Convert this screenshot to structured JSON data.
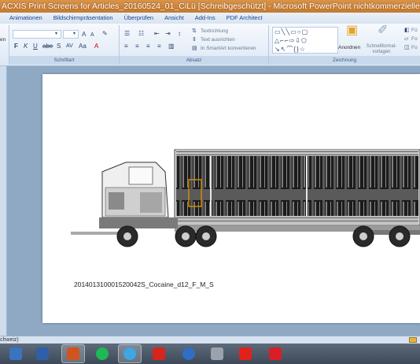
{
  "window": {
    "title": "ACXIS Print Screens for Articles_20160524_01_CiLü [Schreibgeschützt] - Microsoft PowerPoint nichtkommerzielle Verwendung"
  },
  "ribbon_tabs": [
    "Animationen",
    "Bildschirmpräsentation",
    "Überprüfen",
    "Ansicht",
    "Add-Ins",
    "PDF Architect"
  ],
  "ribbon": {
    "font_group_label": "Schriftart",
    "paragraph_group_label": "Absatz",
    "drawing_group_label": "Zeichnung",
    "left_cut_label": "en",
    "text_direction": "Textrichtung",
    "align_text": "Text ausrichten",
    "smartart": "In SmartArt konvertieren",
    "arrange": "Anordnen",
    "quick_styles": "Schnellformat-vorlagen",
    "fill_label": "Fü",
    "outline_label": "Fo",
    "effects_label": "Fo"
  },
  "slide": {
    "caption": "201401310001520042S_Cocaine_d12_F_M_S"
  },
  "statusbar": {
    "language": "chweiz)"
  },
  "taskbar": {
    "icons": [
      "calculator-icon",
      "notes-icon",
      "powerpoint-icon",
      "spotify-icon",
      "internet-explorer-icon",
      "adobe-cloud-icon",
      "pen-icon",
      "lab-icon",
      "acrobat-icon",
      "avira-icon"
    ]
  },
  "colors": {
    "titlebar": "#c77a2e",
    "workspace": "#8fa9c4",
    "taskbar": "#3d4958"
  }
}
